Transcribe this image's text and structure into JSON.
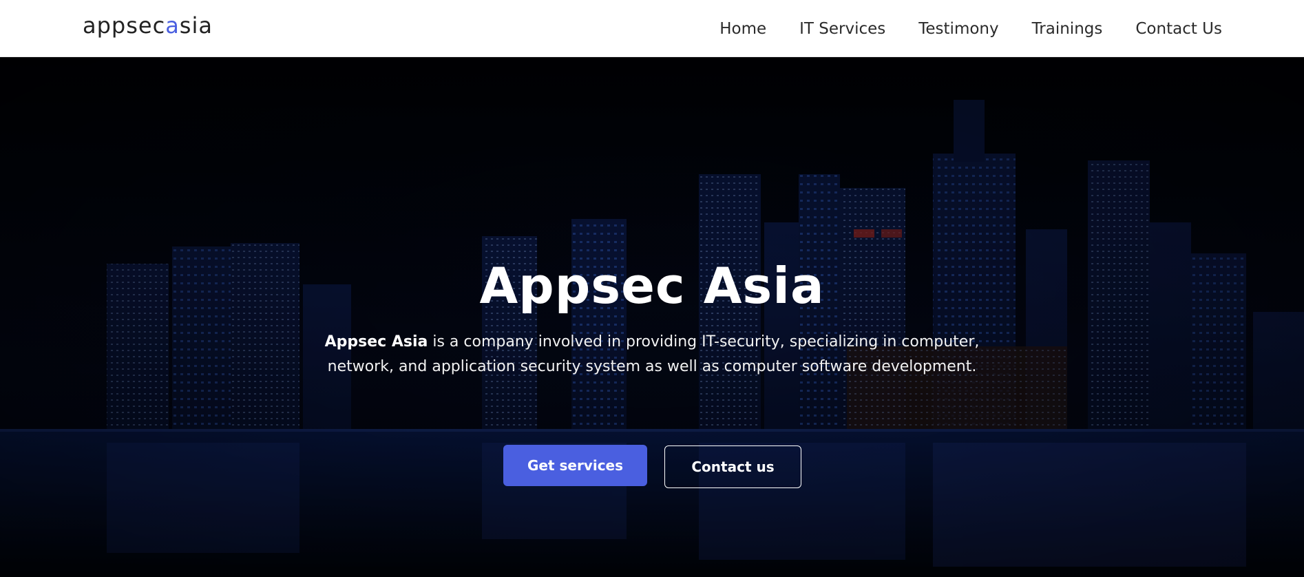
{
  "brand": {
    "logo_part1": "appsec",
    "logo_part2": "a",
    "logo_part3": "sia",
    "accent_color": "#4a5fe0"
  },
  "nav": {
    "items": [
      "Home",
      "IT Services",
      "Testimony",
      "Trainings",
      "Contact Us"
    ]
  },
  "hero": {
    "title": "Appsec Asia",
    "desc_bold": "Appsec Asia",
    "desc_rest": " is a company involved in providing IT-security, specializing in computer, network, and application security system as well as computer software development.",
    "primary_button": "Get services",
    "secondary_button": "Contact us"
  }
}
